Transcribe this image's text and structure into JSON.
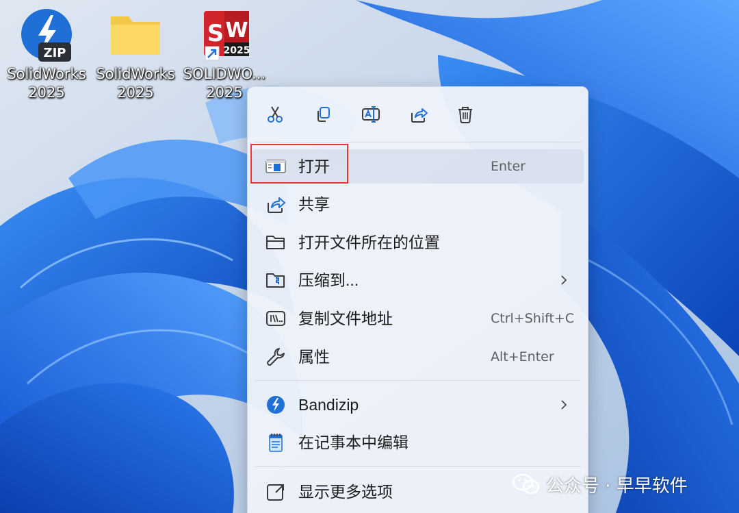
{
  "colors": {
    "accent": "#1f6fd6",
    "highlight_border": "#e53935",
    "sw_red": "#d1252b"
  },
  "desktop": {
    "icons": [
      {
        "caption": "SolidWorks\n2025",
        "icon": "bandizip-zip-archive-icon",
        "badge": "ZIP"
      },
      {
        "caption": "SolidWorks\n2025",
        "icon": "folder-icon"
      },
      {
        "caption": "SOLIDWO...\n2025",
        "icon": "solidworks-shortcut-icon",
        "badge": "2025"
      }
    ]
  },
  "context_menu": {
    "quick_actions": [
      {
        "name": "cut",
        "icon": "scissors-icon"
      },
      {
        "name": "copy",
        "icon": "copy-icon"
      },
      {
        "name": "rename",
        "icon": "rename-icon"
      },
      {
        "name": "share",
        "icon": "share-icon"
      },
      {
        "name": "delete",
        "icon": "trash-icon"
      }
    ],
    "items": [
      {
        "label": "打开",
        "shortcut": "Enter",
        "icon": "open-app-icon"
      },
      {
        "label": "共享",
        "shortcut": "",
        "icon": "share-icon"
      },
      {
        "label": "打开文件所在的位置",
        "shortcut": "",
        "icon": "folder-outline-icon"
      },
      {
        "label": "压缩到...",
        "shortcut": "",
        "icon": "zip-folder-icon",
        "submenu": true
      },
      {
        "label": "复制文件地址",
        "shortcut": "Ctrl+Shift+C",
        "icon": "copy-path-icon"
      },
      {
        "label": "属性",
        "shortcut": "Alt+Enter",
        "icon": "wrench-icon"
      },
      {
        "label": "Bandizip",
        "shortcut": "",
        "icon": "bandizip-icon",
        "submenu": true
      },
      {
        "label": "在记事本中编辑",
        "shortcut": "",
        "icon": "notepad-icon"
      },
      {
        "label": "显示更多选项",
        "shortcut": "",
        "icon": "more-options-icon"
      }
    ]
  },
  "watermark": {
    "text": "公众号 · 早早软件",
    "icon": "wechat-icon"
  }
}
